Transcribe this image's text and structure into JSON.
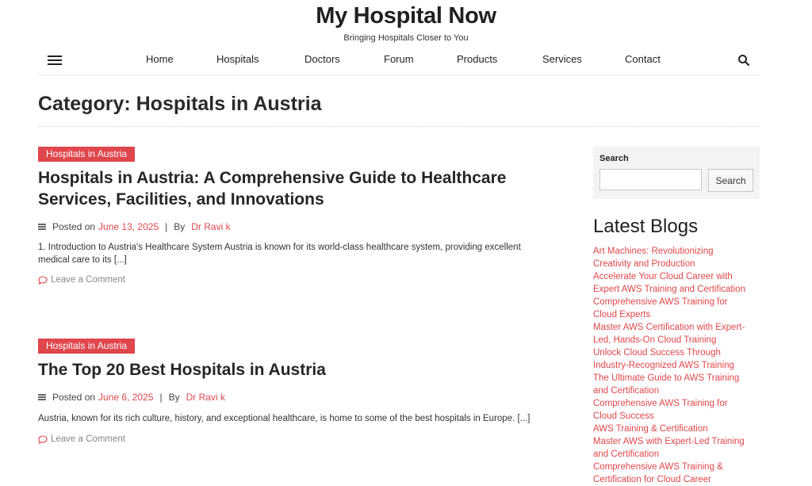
{
  "site": {
    "title": "My Hospital Now",
    "tagline": "Bringing Hospitals Closer to You"
  },
  "nav": {
    "items": [
      "Home",
      "Hospitals",
      "Doctors",
      "Forum",
      "Products",
      "Services",
      "Contact"
    ]
  },
  "category": {
    "title": "Category: Hospitals in Austria"
  },
  "posts": [
    {
      "category": "Hospitals in Austria",
      "title_line1": "Hospitals in Austria: A Comprehensive Guide to Healthcare",
      "title_line2": "Services, Facilities, and Innovations",
      "posted_on": "Posted on",
      "date": "June 13, 2025",
      "separator": "|",
      "by": "By",
      "author": "Dr Ravi k",
      "excerpt_line1": "1. Introduction to Austria's Healthcare System Austria is known for its world-class healthcare system, providing excellent",
      "excerpt_line2": "medical care to its [...]",
      "comment": "Leave a Comment"
    },
    {
      "category": "Hospitals in Austria",
      "title_line1": "The Top 20 Best Hospitals in Austria",
      "posted_on": "Posted on",
      "date": "June 6, 2025",
      "separator": "|",
      "by": "By",
      "author": "Dr Ravi k",
      "excerpt_line1": "Austria, known for its rich culture, history, and exceptional healthcare, is home to some of the best hospitals in Europe. [...]",
      "comment": "Leave a Comment"
    }
  ],
  "sidebar": {
    "search_label": "Search",
    "search_value": "",
    "search_button": "Search",
    "latest_title": "Latest Blogs",
    "latest_lines": [
      "Art Machines: Revolutionizing",
      "Creativity and Production",
      "Accelerate Your Cloud Career with",
      "Expert AWS Training and Certification",
      "Comprehensive AWS Training for",
      "Cloud Experts",
      "Master AWS Certification with Expert-",
      "Led, Hands-On Cloud Training",
      "Unlock Cloud Success Through",
      "Industry-Recognized AWS Training",
      "The Ultimate Guide to AWS Training",
      "and Certification",
      "Comprehensive AWS Training for",
      "Cloud Success",
      "AWS Training & Certification",
      "Master AWS with Expert-Led Training",
      "and Certification",
      "Comprehensive AWS Training &",
      "Certification for Cloud Career"
    ]
  },
  "colors": {
    "accent": "#e0474c",
    "text": "#222222",
    "sidebar_bg": "#f3f3f3"
  },
  "icons": {
    "menu": "hamburger-icon",
    "search": "search-icon",
    "meta": "list-icon",
    "comment": "comment-icon"
  }
}
